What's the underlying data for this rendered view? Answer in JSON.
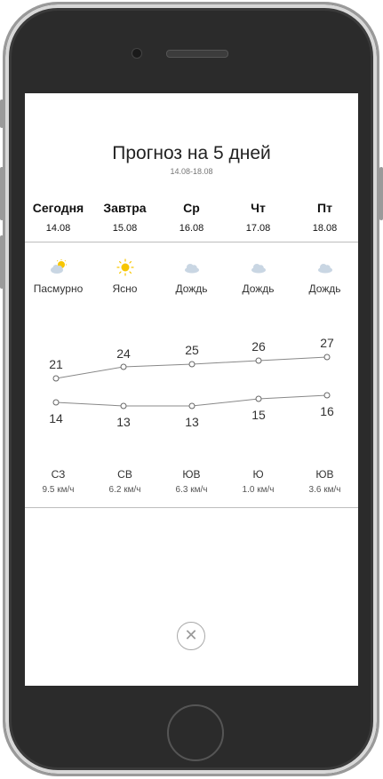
{
  "forecast": {
    "title": "Прогноз на 5 дней",
    "range": "14.08-18.08",
    "close_icon": "close-icon",
    "days": [
      {
        "day": "Сегодня",
        "date": "14.08",
        "icon": "partly-cloudy-icon",
        "condition": "Пасмурно",
        "high": "21",
        "low": "14",
        "wind_dir": "СЗ",
        "wind_speed": "9.5 км/ч"
      },
      {
        "day": "Завтра",
        "date": "15.08",
        "icon": "sun-icon",
        "condition": "Ясно",
        "high": "24",
        "low": "13",
        "wind_dir": "СВ",
        "wind_speed": "6.2 км/ч"
      },
      {
        "day": "Ср",
        "date": "16.08",
        "icon": "cloud-icon",
        "condition": "Дождь",
        "high": "25",
        "low": "13",
        "wind_dir": "ЮВ",
        "wind_speed": "6.3 км/ч"
      },
      {
        "day": "Чт",
        "date": "17.08",
        "icon": "cloud-icon",
        "condition": "Дождь",
        "high": "26",
        "low": "15",
        "wind_dir": "Ю",
        "wind_speed": "1.0 км/ч"
      },
      {
        "day": "Пт",
        "date": "18.08",
        "icon": "cloud-icon",
        "condition": "Дождь",
        "high": "27",
        "low": "16",
        "wind_dir": "ЮВ",
        "wind_speed": "3.6 км/ч"
      }
    ]
  },
  "colors": {
    "line": "#888888",
    "sun": "#f7c600",
    "cloud": "#c9d6e3"
  }
}
